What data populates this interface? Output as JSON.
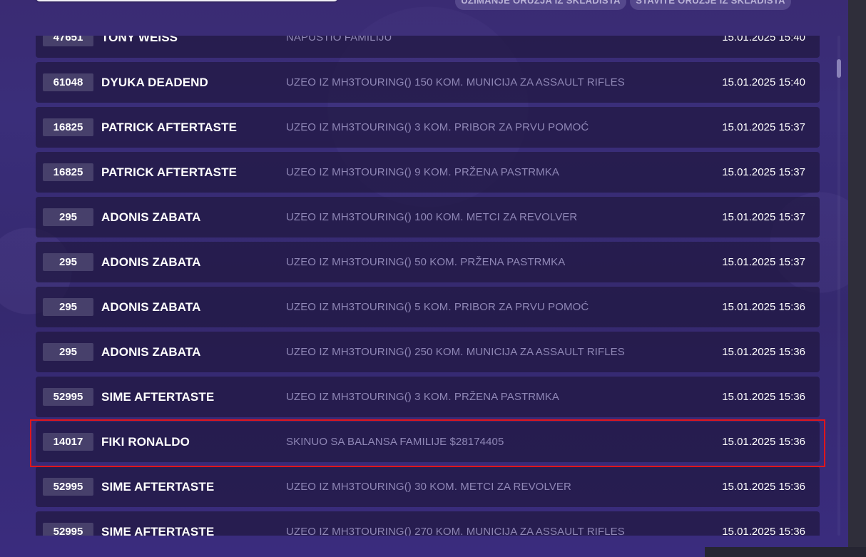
{
  "top": {
    "button_left": "UZIMANJE ORUŽJA IZ SKLADIŠTA",
    "button_right": "STAVITE ORUŽJE IZ SKLADIŠTA"
  },
  "log": [
    {
      "id": "47651",
      "name": "TONY WEISS",
      "action": "NAPUSTIO FAMILIJU",
      "time": "15.01.2025 15:40"
    },
    {
      "id": "61048",
      "name": "DYUKA DEADEND",
      "action": "UZEO IZ MH3TOURING() 150 KOM. MUNICIJA ZA ASSAULT RIFLES",
      "time": "15.01.2025 15:40"
    },
    {
      "id": "16825",
      "name": "PATRICK AFTERTASTE",
      "action": "UZEO IZ MH3TOURING() 3 KOM. PRIBOR ZA PRVU POMOĆ",
      "time": "15.01.2025 15:37"
    },
    {
      "id": "16825",
      "name": "PATRICK AFTERTASTE",
      "action": "UZEO IZ MH3TOURING() 9 KOM. PRŽENA PASTRMKA",
      "time": "15.01.2025 15:37"
    },
    {
      "id": "295",
      "name": "ADONIS ZABATA",
      "action": "UZEO IZ MH3TOURING() 100 KOM. METCI ZA REVOLVER",
      "time": "15.01.2025 15:37"
    },
    {
      "id": "295",
      "name": "ADONIS ZABATA",
      "action": "UZEO IZ MH3TOURING() 50 KOM. PRŽENA PASTRMKA",
      "time": "15.01.2025 15:37"
    },
    {
      "id": "295",
      "name": "ADONIS ZABATA",
      "action": "UZEO IZ MH3TOURING() 5 KOM. PRIBOR ZA PRVU POMOĆ",
      "time": "15.01.2025 15:36"
    },
    {
      "id": "295",
      "name": "ADONIS ZABATA",
      "action": "UZEO IZ MH3TOURING() 250 KOM. MUNICIJA ZA ASSAULT RIFLES",
      "time": "15.01.2025 15:36"
    },
    {
      "id": "52995",
      "name": "SIME AFTERTASTE",
      "action": "UZEO IZ MH3TOURING() 3 KOM. PRŽENA PASTRMKA",
      "time": "15.01.2025 15:36"
    },
    {
      "id": "14017",
      "name": "FIKI RONALDO",
      "action": "SKINUO SA BALANSA FAMILIJE $28174405",
      "time": "15.01.2025 15:36"
    },
    {
      "id": "52995",
      "name": "SIME AFTERTASTE",
      "action": "UZEO IZ MH3TOURING() 30 KOM. METCI ZA REVOLVER",
      "time": "15.01.2025 15:36"
    },
    {
      "id": "52995",
      "name": "SIME AFTERTASTE",
      "action": "UZEO IZ MH3TOURING() 270 KOM. MUNICIJA ZA ASSAULT RIFLES",
      "time": "15.01.2025 15:36"
    }
  ],
  "highlighted_row_index": 9,
  "colors": {
    "highlight_border": "#e0161c",
    "id_badge": "#47406b",
    "action_text": "#8f87b6"
  }
}
